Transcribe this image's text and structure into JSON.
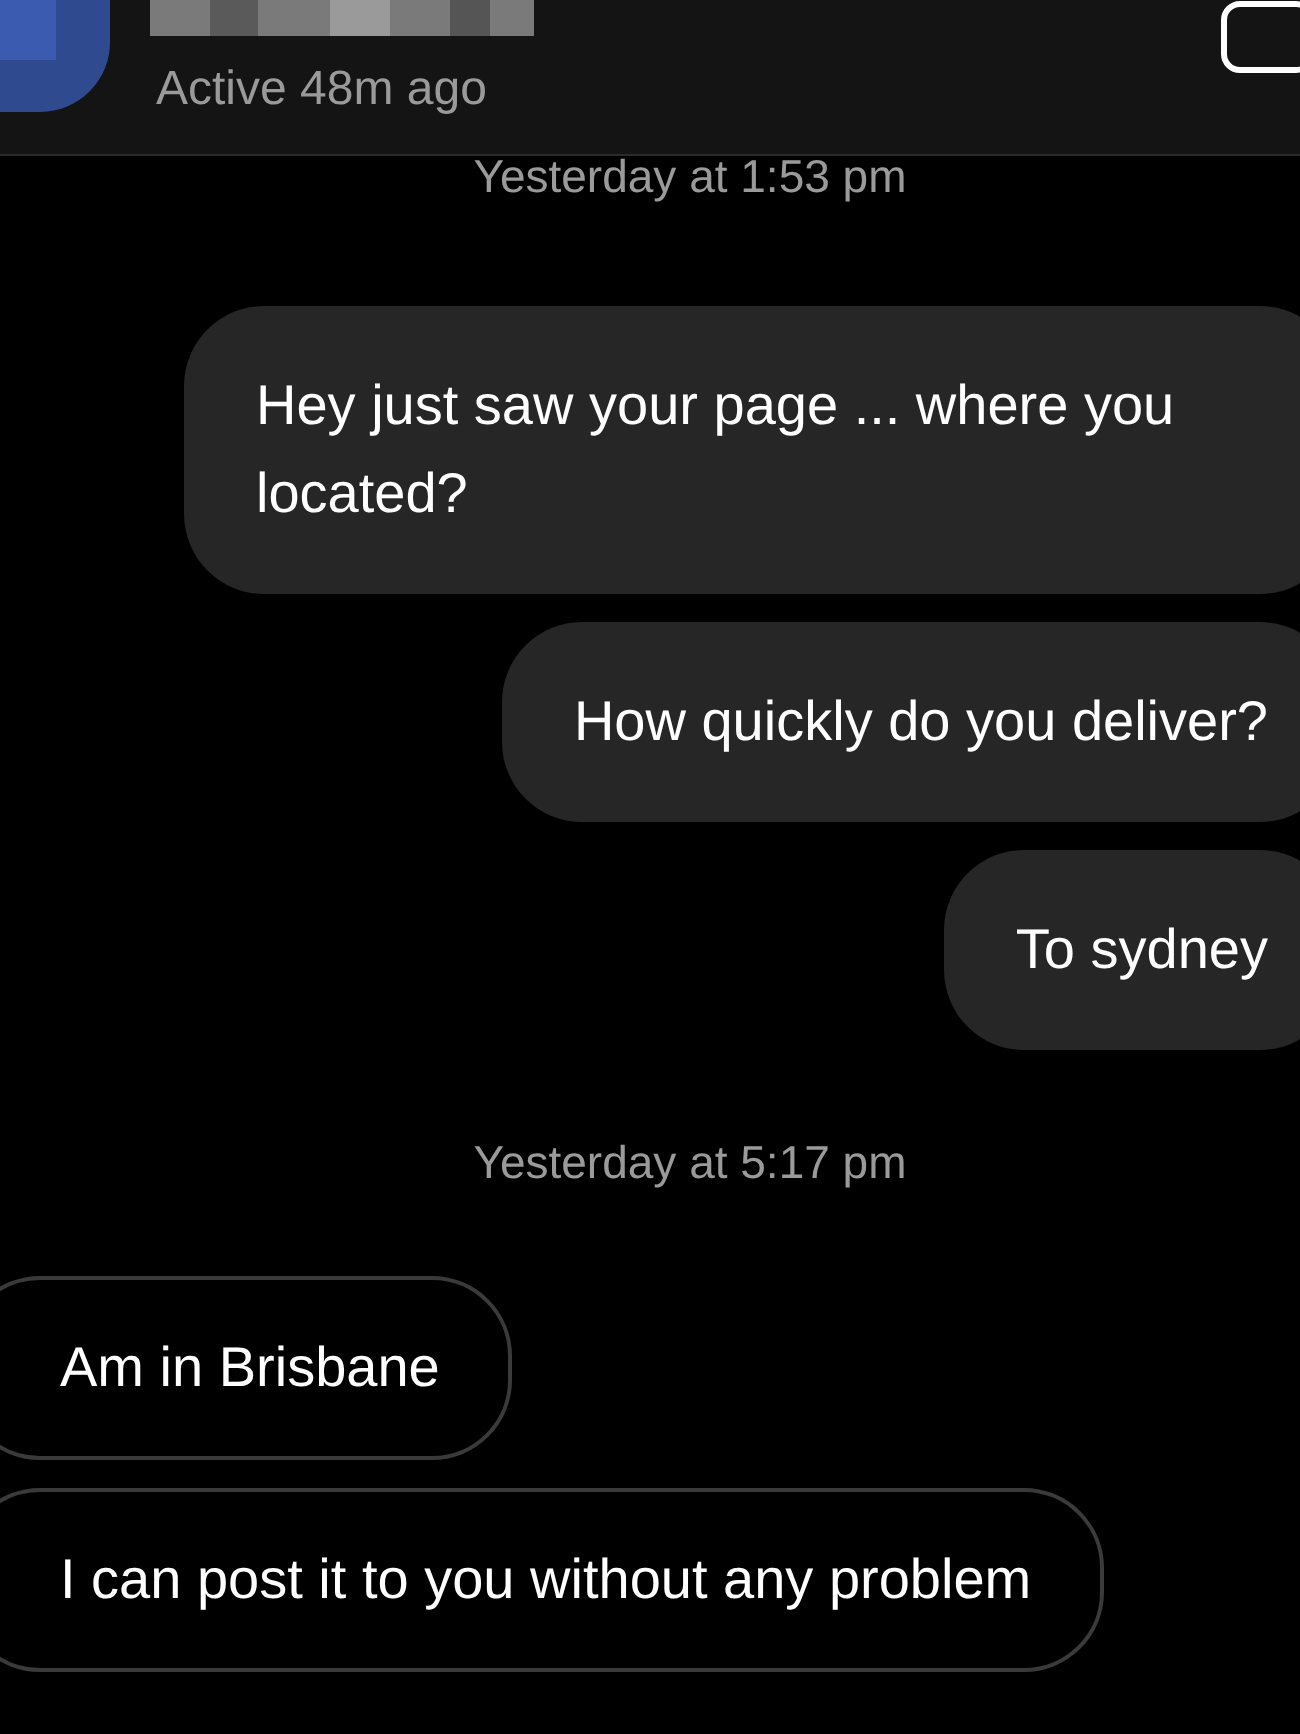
{
  "header": {
    "status": "Active 48m ago"
  },
  "messages": [
    {
      "kind": "timestamp",
      "text": "Yesterday at 1:53 pm"
    },
    {
      "kind": "sent",
      "text": "Hey just saw your page ... where you located?"
    },
    {
      "kind": "sent",
      "text": "How quickly do you deliver?"
    },
    {
      "kind": "sent",
      "text": "To sydney"
    },
    {
      "kind": "timestamp",
      "text": "Yesterday at 5:17 pm"
    },
    {
      "kind": "received",
      "text": "Am in Brisbane"
    },
    {
      "kind": "received",
      "text": "I can post it to you without any problem"
    }
  ]
}
